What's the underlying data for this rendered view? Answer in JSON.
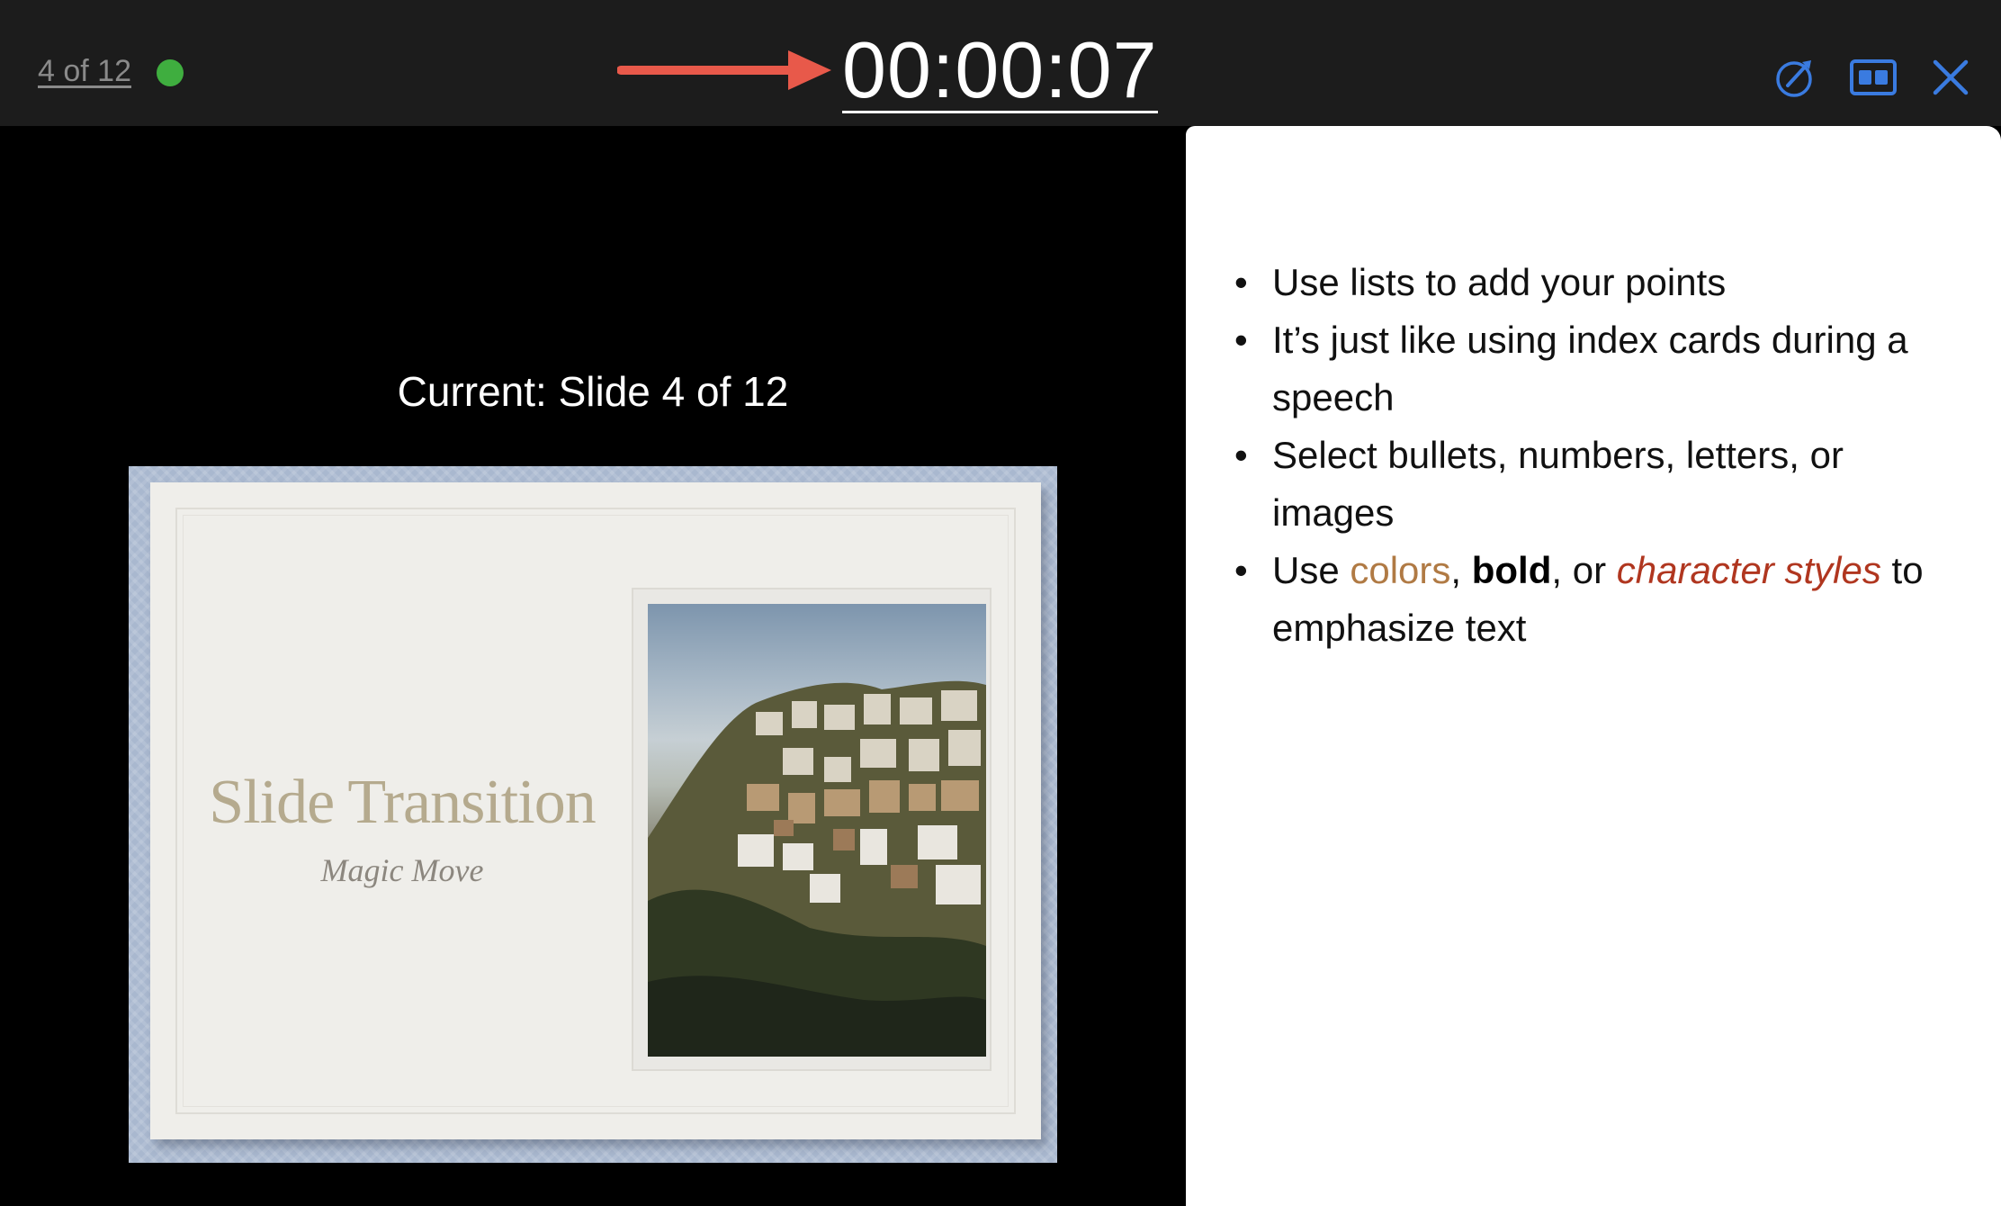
{
  "header": {
    "slide_counter": "4 of 12",
    "timer": "00:00:07",
    "status_color": "#3fae3f",
    "arrow_color": "#e8594a",
    "icon_color": "#3a7be0",
    "tools": [
      "annotate-icon",
      "layout-icon",
      "close-icon"
    ]
  },
  "stage": {
    "current_label": "Current: Slide 4 of 12",
    "slide": {
      "title": "Slide Transition",
      "subtitle": "Magic Move"
    }
  },
  "notes": {
    "bullets": [
      "Use lists to add your points",
      "It’s just like using index cards during a speech",
      "Select bullets, numbers, letters, or images"
    ],
    "last_bullet": {
      "prefix": "Use ",
      "colors": "colors",
      "sep1": ", ",
      "bold": "bold",
      "sep2": ", or ",
      "character": "character styles",
      "suffix": " to emphasize text"
    }
  }
}
